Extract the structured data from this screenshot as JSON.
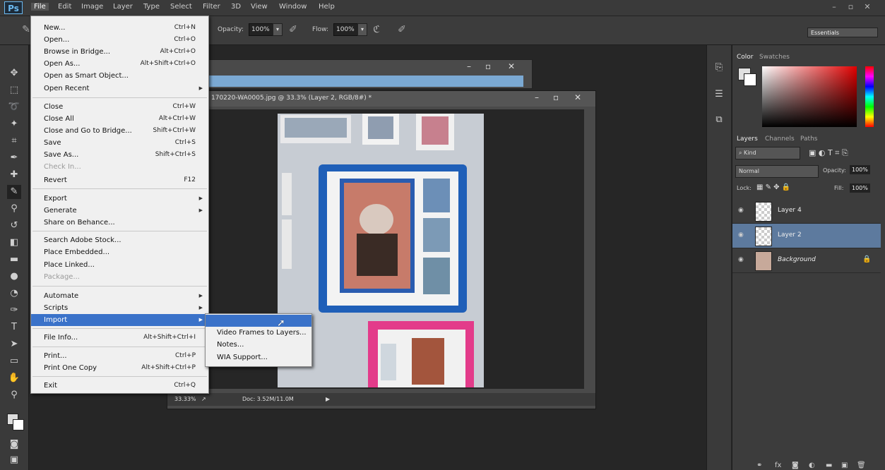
{
  "menubar": {
    "logo": "Ps",
    "items": [
      "File",
      "Edit",
      "Image",
      "Layer",
      "Type",
      "Select",
      "Filter",
      "3D",
      "View",
      "Window",
      "Help"
    ],
    "window_controls": [
      "–",
      "▫",
      "✕"
    ]
  },
  "options": {
    "opacity_label": "Opacity:",
    "opacity_value": "100%",
    "flow_label": "Flow:",
    "flow_value": "100%",
    "workspace": "Essentials"
  },
  "file_menu": {
    "items": [
      {
        "label": "New...",
        "shortcut": "Ctrl+N"
      },
      {
        "label": "Open...",
        "shortcut": "Ctrl+O"
      },
      {
        "label": "Browse in Bridge...",
        "shortcut": "Alt+Ctrl+O"
      },
      {
        "label": "Open As...",
        "shortcut": "Alt+Shift+Ctrl+O"
      },
      {
        "label": "Open as Smart Object...",
        "shortcut": ""
      },
      {
        "label": "Open Recent",
        "shortcut": ""
      },
      {
        "label": "Close",
        "shortcut": "Ctrl+W"
      },
      {
        "label": "Close All",
        "shortcut": "Alt+Ctrl+W"
      },
      {
        "label": "Close and Go to Bridge...",
        "shortcut": "Shift+Ctrl+W"
      },
      {
        "label": "Save",
        "shortcut": "Ctrl+S"
      },
      {
        "label": "Save As...",
        "shortcut": "Shift+Ctrl+S"
      },
      {
        "label": "Check In...",
        "shortcut": ""
      },
      {
        "label": "Revert",
        "shortcut": "F12"
      },
      {
        "label": "Export",
        "shortcut": ""
      },
      {
        "label": "Generate",
        "shortcut": ""
      },
      {
        "label": "Share on Behance...",
        "shortcut": ""
      },
      {
        "label": "Search Adobe Stock...",
        "shortcut": ""
      },
      {
        "label": "Place Embedded...",
        "shortcut": ""
      },
      {
        "label": "Place Linked...",
        "shortcut": ""
      },
      {
        "label": "Package...",
        "shortcut": ""
      },
      {
        "label": "Automate",
        "shortcut": ""
      },
      {
        "label": "Scripts",
        "shortcut": ""
      },
      {
        "label": "Import",
        "shortcut": ""
      },
      {
        "label": "File Info...",
        "shortcut": "Alt+Shift+Ctrl+I"
      },
      {
        "label": "Print...",
        "shortcut": "Ctrl+P"
      },
      {
        "label": "Print One Copy",
        "shortcut": "Alt+Shift+Ctrl+P"
      },
      {
        "label": "Exit",
        "shortcut": "Ctrl+Q"
      }
    ]
  },
  "import_submenu": {
    "items": [
      "Video Frames to Layers...",
      "Notes...",
      "WIA Support..."
    ]
  },
  "document": {
    "title": "170220-WA0005.jpg @ 33.3% (Layer 2, RGB/8#) *",
    "zoom": "33.33%",
    "doc_info": "Doc: 3.52M/11.0M"
  },
  "color_panel": {
    "tabs": [
      "Color",
      "Swatches"
    ]
  },
  "layers_panel": {
    "tabs": [
      "Layers",
      "Channels",
      "Paths"
    ],
    "kind_label": "Kind",
    "blend_mode": "Normal",
    "opacity_label": "Opacity:",
    "opacity_value": "100%",
    "lock_label": "Lock:",
    "fill_label": "Fill:",
    "fill_value": "100%",
    "layers": [
      {
        "name": "Layer 4",
        "selected": false
      },
      {
        "name": "Layer 2",
        "selected": true
      },
      {
        "name": "Background",
        "selected": false
      }
    ]
  },
  "colors": {
    "highlight": "#3a72c9",
    "menu_bg": "#f0f0f0",
    "layer_selected": "#5d7a9e"
  }
}
